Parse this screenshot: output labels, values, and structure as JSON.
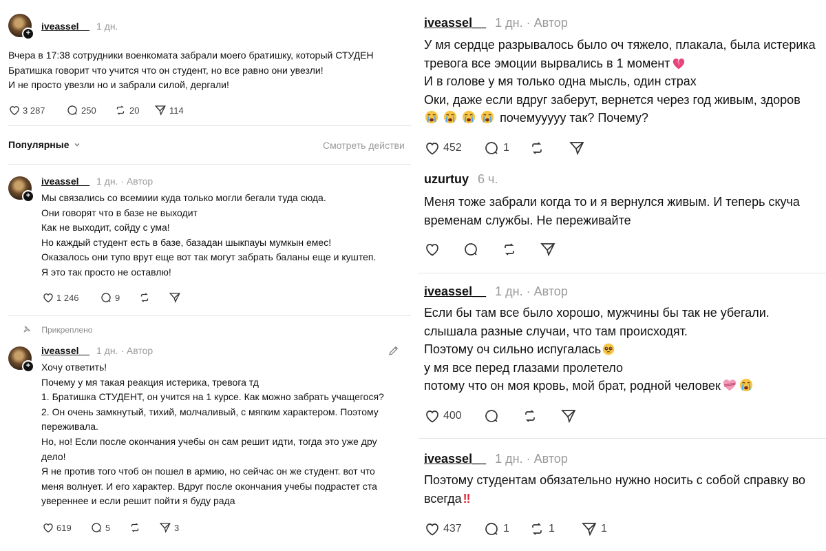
{
  "left": {
    "post": {
      "username": "iveassel__",
      "time": "1 дн.",
      "lines": [
        "Вчера в 17:38 сотрудники военкомата забрали моего братишку, который СТУДЕН",
        "Братишка говорит что учится что он студент, но все равно они увезли!",
        "И не просто увезли но и забрали силой, дергали!"
      ],
      "likes": "3 287",
      "comments": "250",
      "reposts": "20",
      "shares": "114"
    },
    "sort": {
      "label": "Популярные",
      "view_activity": "Смотреть действи"
    },
    "reply1": {
      "username": "iveassel__",
      "time": "1 дн.",
      "author": "Автор",
      "lines": [
        "Мы связались со всемиии куда только могли бегали туда сюда.",
        "Они говорят что в базе не выходит",
        "Как не выходит, сойду с ума!",
        "Но каждый студент есть в базе, базадан шыкпауы мумкын емес!",
        "Оказалось они тупо врут еще вот так могут забрать баланы еще и куштеп.",
        "Я это так просто не оставлю!"
      ],
      "likes": "1 246",
      "comments": "9"
    },
    "reply2": {
      "pinned": "Прикреплено",
      "username": "iveassel__",
      "time": "1 дн.",
      "author": "Автор",
      "lines": [
        "Хочу ответить!",
        "Почему у мя такая реакция истерика, тревога тд",
        "1. Братишка СТУДЕНТ, он учится на 1 курсе. Как можно забрать учащегося?",
        "2. Он очень замкнутый, тихий, молчаливый, с мягким характером. Поэтому",
        "переживала.",
        "Но, но! Если после окончания учебы он сам решит идти, тогда это уже дру",
        "дело!",
        "Я не против того чтоб он пошел в армию, но сейчас он же студент. вот что",
        "меня волнует. И его характер. Вдруг после окончания учебы подрастет ста",
        "увереннее и если решит пойти я буду рада"
      ],
      "likes": "619",
      "comments": "5",
      "shares": "3"
    }
  },
  "right": {
    "c1": {
      "username": "iveassel__",
      "time": "1 дн.",
      "author": "Автор",
      "lines": [
        "У мя сердце разрывалось было оч тяжело, плакала, была истерика",
        "тревога все эмоции вырвались в 1 момент",
        "И в голове у мя только одна мысль, один страх",
        "Оки, даже если вдруг заберут, вернется через год живым, здоров",
        "почемуyyyy так? Почему?"
      ],
      "likes": "452",
      "comments": "1"
    },
    "c2": {
      "username": "uzurtuy",
      "time": "6 ч.",
      "lines": [
        "Меня тоже забрали когда то и я вернулся живым. И теперь скуча",
        "временам службы. Не переживайте"
      ]
    },
    "c3": {
      "username": "iveassel__",
      "time": "1 дн.",
      "author": "Автор",
      "lines": [
        "Если бы там все было хорошо, мужчины бы так не убегали.",
        "слышала разные случаи, что там происходят.",
        "Поэтому оч сильно испугалась",
        "у мя все перед глазами пролетело",
        "потому что он моя кровь, мой брат, родной человек"
      ],
      "likes": "400"
    },
    "c4": {
      "username": "iveassel__",
      "time": "1 дн.",
      "author": "Автор",
      "lines": [
        "Поэтому студентам обязательно нужно носить с собой справку во",
        "всегда"
      ],
      "likes": "437",
      "comments": "1",
      "reposts": "1",
      "shares": "1"
    }
  },
  "icons": {
    "heart": "heart-icon",
    "comment": "comment-icon",
    "repost": "repost-icon",
    "share": "share-icon",
    "pin": "pin-icon",
    "edit": "edit-icon",
    "broken_heart": "broken-heart-icon",
    "crying_face": "crying-face-icon",
    "pleading_face": "pleading-face-icon",
    "heart_ribbon": "heart-ribbon-icon",
    "double_exclamation": "double-exclamation-icon"
  },
  "colors": {
    "text": "#111111",
    "muted": "#9a9a9a",
    "divider": "#e4e4e4",
    "broken_heart": "#e8457a",
    "alert": "#e0263a"
  }
}
